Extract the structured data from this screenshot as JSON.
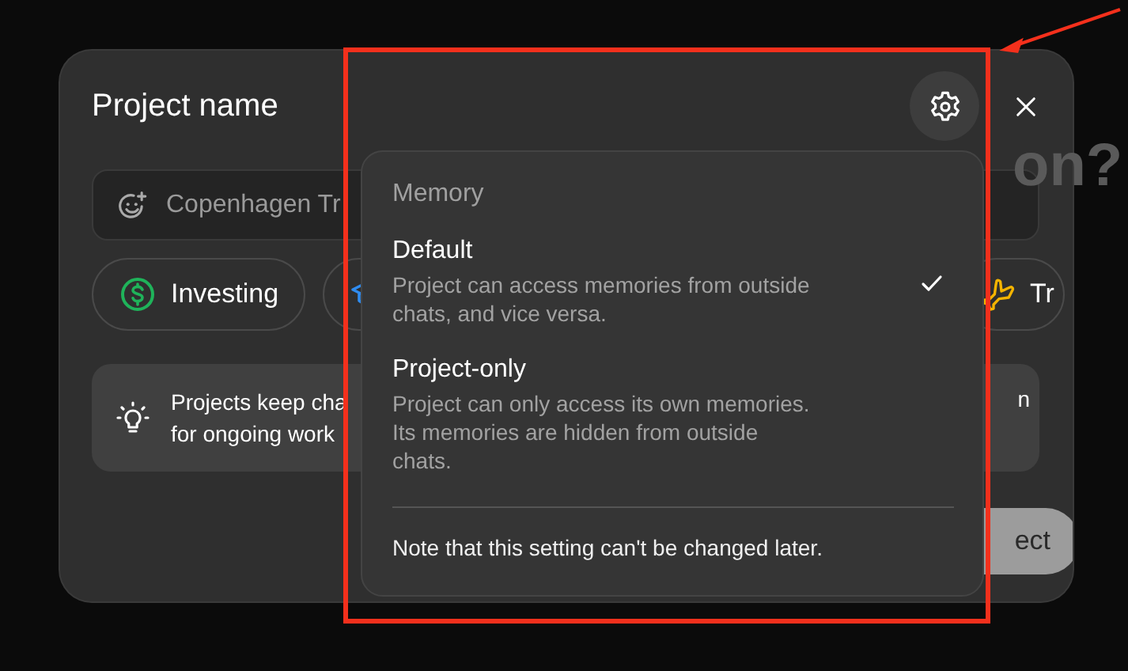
{
  "background_text": "on?",
  "dialog": {
    "title": "Project name",
    "name_field": {
      "placeholder": "Copenhagen Tr"
    },
    "chips": [
      {
        "label": "Investing",
        "kind": "dollar"
      },
      {
        "kind": "cap"
      },
      {
        "label": "Tr",
        "kind": "plane"
      }
    ],
    "info": {
      "lines": [
        "Projects keep cha",
        "for ongoing work"
      ],
      "line_end": "n"
    },
    "create_button": "ect"
  },
  "memory_menu": {
    "heading": "Memory",
    "options": [
      {
        "title": "Default",
        "description_lines": [
          "Project can access memories from outside",
          "chats, and vice versa."
        ],
        "selected": true
      },
      {
        "title": "Project-only",
        "description_lines": [
          "Project can only access its own memories.",
          "Its memories are hidden from outside",
          "chats."
        ],
        "selected": false
      }
    ],
    "note": "Note that this setting can't be changed later."
  }
}
